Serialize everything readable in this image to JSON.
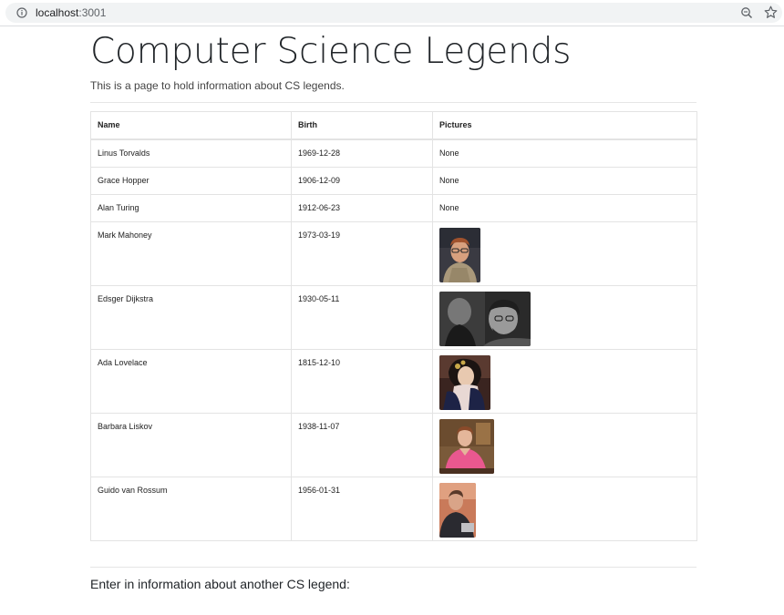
{
  "browser": {
    "url_host": "localhost",
    "url_port": ":3001"
  },
  "page": {
    "title": "Computer Science Legends",
    "lead": "This is a page to hold information about CS legends."
  },
  "table": {
    "headers": {
      "name": "Name",
      "birth": "Birth",
      "pictures": "Pictures"
    },
    "rows": [
      {
        "name": "Linus Torvalds",
        "birth": "1969-12-28",
        "pictures": "None"
      },
      {
        "name": "Grace Hopper",
        "birth": "1906-12-09",
        "pictures": "None"
      },
      {
        "name": "Alan Turing",
        "birth": "1912-06-23",
        "pictures": "None"
      },
      {
        "name": "Mark Mahoney",
        "birth": "1973-03-19",
        "pictures": ""
      },
      {
        "name": "Edsger Dijkstra",
        "birth": "1930-05-11",
        "pictures": ""
      },
      {
        "name": "Ada Lovelace",
        "birth": "1815-12-10",
        "pictures": ""
      },
      {
        "name": "Barbara Liskov",
        "birth": "1938-11-07",
        "pictures": ""
      },
      {
        "name": "Guido van Rossum",
        "birth": "1956-01-31",
        "pictures": ""
      }
    ]
  },
  "form": {
    "heading": "Enter in information about another CS legend:"
  }
}
